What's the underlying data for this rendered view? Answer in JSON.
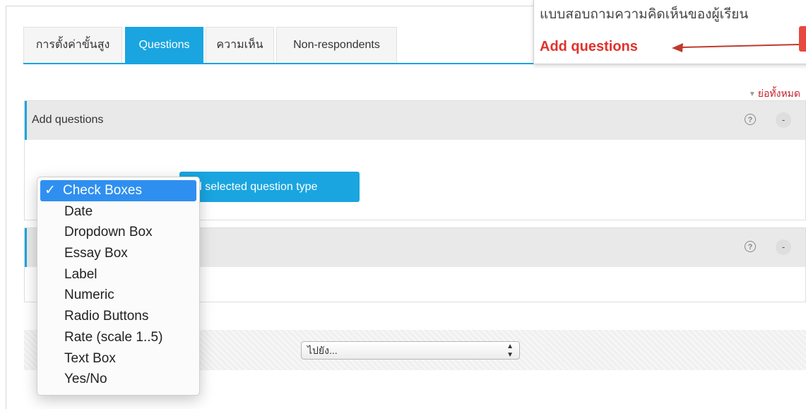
{
  "tabs": [
    {
      "label": "การตั้งค่าขั้นสูง",
      "active": false
    },
    {
      "label": "Questions",
      "active": true
    },
    {
      "label": "ความเห็น",
      "active": false
    },
    {
      "label": "Non-respondents",
      "active": false
    }
  ],
  "callout": {
    "text": "แบบสอบถามความคิดเห็นของผู้เรียน",
    "title": "Add questions"
  },
  "collapse_all": "ย่อทั้งหมด",
  "section1": {
    "title": "Add questions"
  },
  "add_button": "Add selected question type",
  "add_button_visible": "dd selected question type",
  "dropdown": {
    "check_glyph": "✓",
    "options": [
      "Check Boxes",
      "Date",
      "Dropdown Box",
      "Essay Box",
      "Label",
      "Numeric",
      "Radio Buttons",
      "Rate (scale 1..5)",
      "Text Box",
      "Yes/No"
    ],
    "selected": "Check Boxes"
  },
  "jump_select": {
    "value": "ไปยัง..."
  },
  "icons": {
    "help": "?",
    "collapse": "-"
  },
  "colors": {
    "accent": "#1aa5e0",
    "callout_red": "#e0322c",
    "selection_blue": "#2f8ff0"
  }
}
